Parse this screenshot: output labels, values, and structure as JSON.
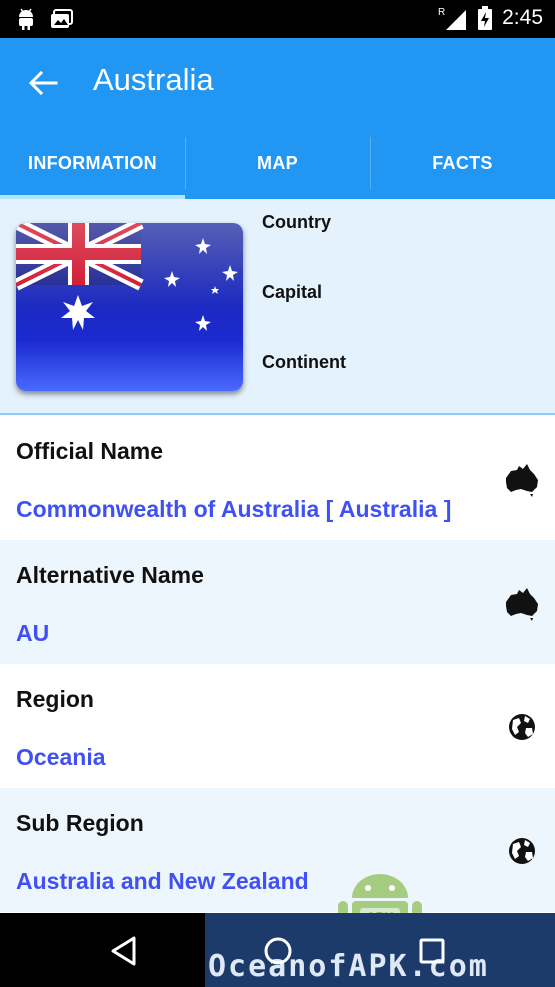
{
  "status_bar": {
    "time": "2:45",
    "network_badge": "R",
    "icons": [
      "android-icon",
      "photo-notification-icon",
      "signal-icon",
      "battery-charging-icon"
    ]
  },
  "app_bar": {
    "title": "Australia",
    "back_icon": "arrow-back-icon"
  },
  "tabs": [
    {
      "label": "INFORMATION",
      "active": true
    },
    {
      "label": "MAP",
      "active": false
    },
    {
      "label": "FACTS",
      "active": false
    }
  ],
  "header": {
    "flag_icon": "australia-flag",
    "labels": [
      "Country",
      "Capital",
      "Continent"
    ]
  },
  "details": [
    {
      "label": "Official Name",
      "value": "Commonwealth of Australia [ Australia ]",
      "icon": "australia-map-icon",
      "bg": "#ffffff"
    },
    {
      "label": "Alternative Name",
      "value": "AU",
      "icon": "australia-map-icon",
      "bg": "#EEF6FD"
    },
    {
      "label": "Region",
      "value": "Oceania",
      "icon": "globe-icon",
      "bg": "#ffffff"
    },
    {
      "label": "Sub Region",
      "value": "Australia and New Zealand",
      "icon": "globe-icon",
      "bg": "#EEF6FD"
    }
  ],
  "nav_bar": {
    "buttons": [
      "back-triangle-icon",
      "home-circle-icon",
      "recents-square-icon"
    ]
  },
  "watermark": {
    "text": "OceanofAPK.com",
    "badge": "APK"
  },
  "colors": {
    "primary": "#2196F3",
    "value_text": "#3F51F5",
    "tab_indicator": "#B3E5FC",
    "header_bg": "#E3F2FD"
  }
}
